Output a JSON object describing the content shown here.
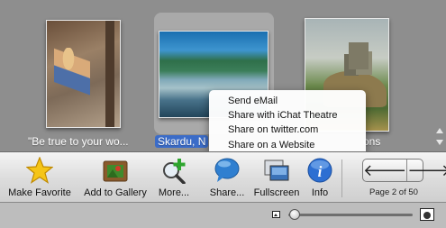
{
  "gallery": {
    "photos": [
      {
        "caption": "\"Be true to your wo..."
      },
      {
        "caption": "Skardu, N",
        "selected": true
      },
      {
        "caption": "ons"
      }
    ]
  },
  "context_menu": {
    "items": [
      "Send eMail",
      "Share with iChat Theatre",
      "Share on twitter.com",
      "Share on a Website"
    ]
  },
  "toolbar": {
    "make_favorite": "Make Favorite",
    "add_to_gallery": "Add to Gallery",
    "more": "More...",
    "share": "Share...",
    "fullscreen": "Fullscreen",
    "info": "Info",
    "page_label": "Page 2 of 50",
    "prev_arrow": "🡐",
    "next_arrow": "🡒"
  },
  "zoom": {
    "level": 0.02
  },
  "colors": {
    "selection": "#3b6cc8",
    "info_blue": "#2d6fd2",
    "star_gold": "#f5c516"
  }
}
